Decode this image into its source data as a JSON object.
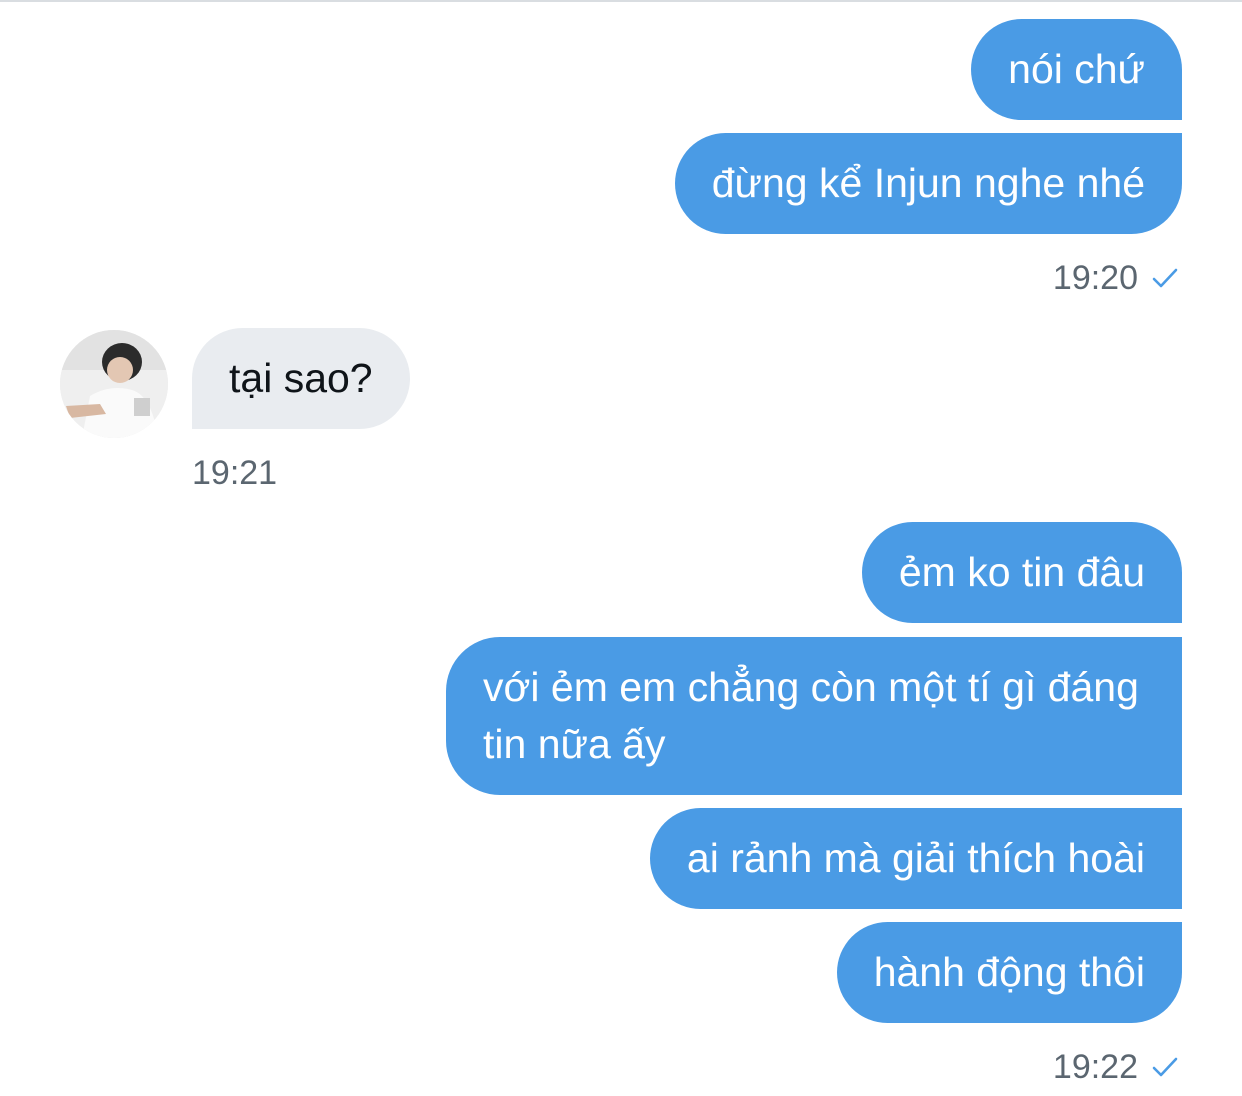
{
  "messages": {
    "group1": {
      "m1": "nói chứ",
      "m2": "đừng kể Injun nghe nhé",
      "time": "19:20"
    },
    "group2": {
      "m1": "tại sao?",
      "time": "19:21"
    },
    "group3": {
      "m1": "ẻm ko tin đâu",
      "m2": "với ẻm em chẳng còn một tí gì đáng tin nữa ấy",
      "m3": "ai rảnh mà giải thích hoài",
      "m4": "hành động thôi",
      "time": "19:22"
    }
  },
  "colors": {
    "outgoing_bubble": "#4a9be5",
    "incoming_bubble": "#e9ecf0",
    "read_check": "#4a9be5",
    "timestamp": "#5b6670"
  },
  "icons": {
    "read_receipt": "check-icon",
    "avatar": "user-avatar"
  }
}
